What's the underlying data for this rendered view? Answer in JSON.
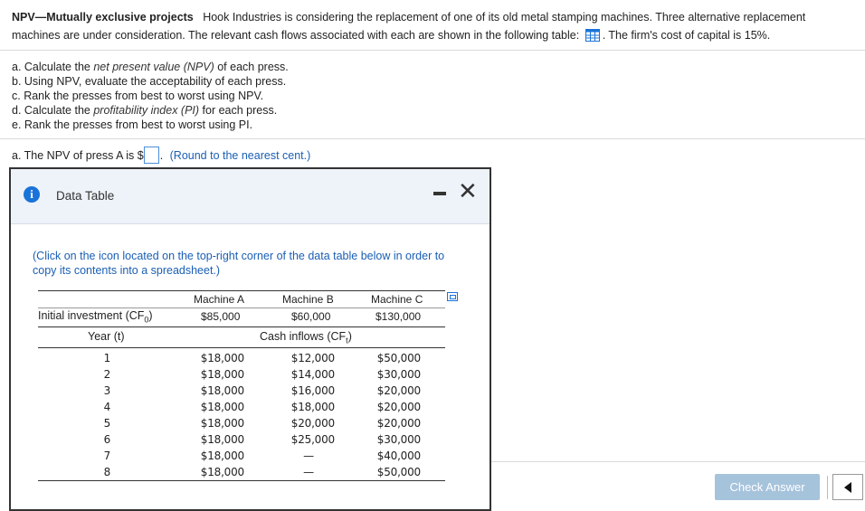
{
  "problem": {
    "title": "NPV—Mutually exclusive projects",
    "text1": "Hook Industries is considering the replacement of one of its old metal stamping machines. Three alternative replacement machines are under consideration. The relevant cash flows associated with each are shown in the following table:",
    "text2": ". The firm's cost of capital is 15%."
  },
  "tasks": [
    {
      "pre": "a. Calculate the ",
      "em": "net present value (NPV)",
      "post": " of each press."
    },
    {
      "pre": "b. Using NPV, evaluate the acceptability of each press.",
      "em": "",
      "post": ""
    },
    {
      "pre": "c. Rank the presses from best to worst using NPV.",
      "em": "",
      "post": ""
    },
    {
      "pre": "d. Calculate the ",
      "em": "profitability index (PI)",
      "post": " for each press."
    },
    {
      "pre": "e. Rank the presses from best to worst using PI.",
      "em": "",
      "post": ""
    }
  ],
  "answer": {
    "prefix": "a. The NPV of press A is $",
    "hint": "(Round to the nearest cent.)"
  },
  "modal": {
    "title": "Data Table",
    "note": "(Click on the icon located on the top-right corner of the data table below in order to copy its contents into a spreadsheet.)",
    "machines": [
      "Machine A",
      "Machine B",
      "Machine C"
    ],
    "initial_label": "Initial investment (CF",
    "initial_sub": "0",
    "initial_values": [
      "$85,000",
      "$60,000",
      "$130,000"
    ],
    "year_label": "Year (t)",
    "inflows_label": "Cash inflows (CF",
    "inflows_sub": "t",
    "years": [
      "1",
      "2",
      "3",
      "4",
      "5",
      "6",
      "7",
      "8"
    ],
    "machine_a": [
      "$18,000",
      "$18,000",
      "$18,000",
      "$18,000",
      "$18,000",
      "$18,000",
      "$18,000",
      "$18,000"
    ],
    "machine_b": [
      "$12,000",
      "$14,000",
      "$16,000",
      "$18,000",
      "$20,000",
      "$25,000",
      "—",
      "—"
    ],
    "machine_c": [
      "$50,000",
      "$30,000",
      "$20,000",
      "$20,000",
      "$20,000",
      "$30,000",
      "$40,000",
      "$50,000"
    ]
  },
  "footer": {
    "check_answer": "Check Answer"
  }
}
